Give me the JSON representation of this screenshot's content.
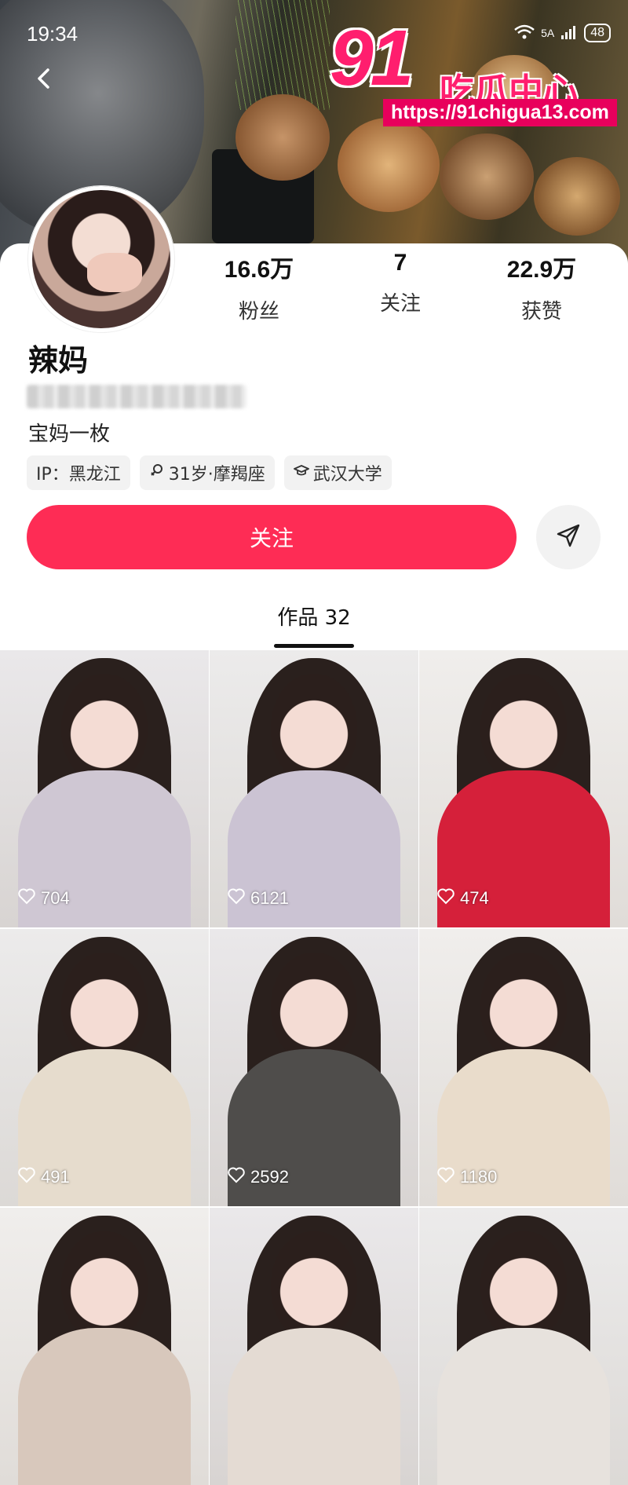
{
  "status_bar": {
    "time": "19:34",
    "network": "5A",
    "battery": "48"
  },
  "watermark": {
    "number": "91",
    "name": "吃瓜中心",
    "url": "https://91chigua13.com"
  },
  "profile": {
    "name": "辣妈",
    "bio": "宝妈一枚",
    "tags": [
      {
        "icon": "none",
        "label": "IP：黑龙江"
      },
      {
        "icon": "female-icon",
        "label": "31岁·摩羯座"
      },
      {
        "icon": "graduation-cap-icon",
        "label": "武汉大学"
      }
    ],
    "stats": [
      {
        "value": "16.6万",
        "label": "粉丝"
      },
      {
        "value": "7",
        "label": "关注"
      },
      {
        "value": "22.9万",
        "label": "获赞"
      }
    ]
  },
  "actions": {
    "follow_label": "关注"
  },
  "tabs": {
    "works_label": "作品 32"
  },
  "grid": [
    {
      "likes": "704",
      "outfit": "#cfc7d3"
    },
    {
      "likes": "6121",
      "outfit": "#cbc3d3"
    },
    {
      "likes": "474",
      "outfit": "#d5203a"
    },
    {
      "likes": "491",
      "outfit": "#e6dccd"
    },
    {
      "likes": "2592",
      "outfit": "#4f4d4b"
    },
    {
      "likes": "1180",
      "outfit": "#e9dccb"
    },
    {
      "likes": "",
      "outfit": "#d8c8bc"
    },
    {
      "likes": "",
      "outfit": "#e4dbd3"
    },
    {
      "likes": "",
      "outfit": "#e7e2dd"
    }
  ],
  "colors": {
    "accent": "#fe2c55",
    "watermark": "#ff1e6e"
  }
}
